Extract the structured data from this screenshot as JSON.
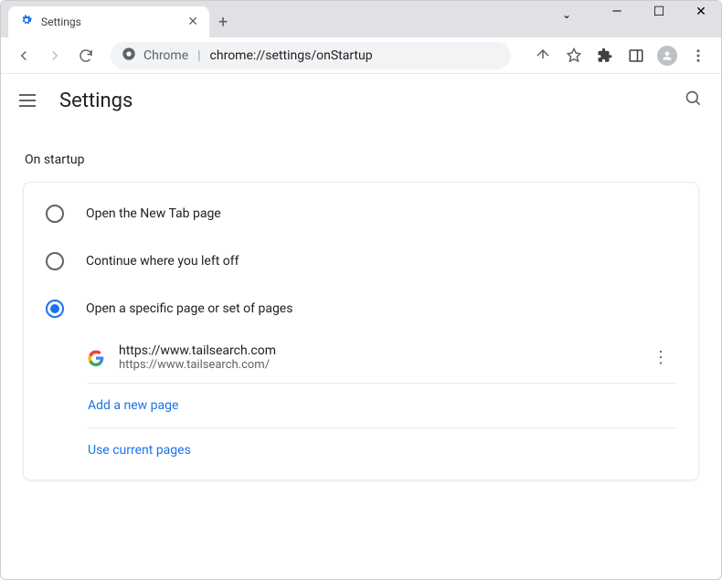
{
  "tab": {
    "title": "Settings"
  },
  "omnibox": {
    "label": "Chrome",
    "path": "chrome://settings/onStartup"
  },
  "header": {
    "title": "Settings"
  },
  "section": {
    "label": "On startup",
    "options": [
      {
        "label": "Open the New Tab page"
      },
      {
        "label": "Continue where you left off"
      },
      {
        "label": "Open a specific page or set of pages"
      }
    ],
    "pages": [
      {
        "title": "https://www.tailsearch.com",
        "url": "https://www.tailsearch.com/"
      }
    ],
    "add_link": "Add a new page",
    "use_current_link": "Use current pages"
  }
}
